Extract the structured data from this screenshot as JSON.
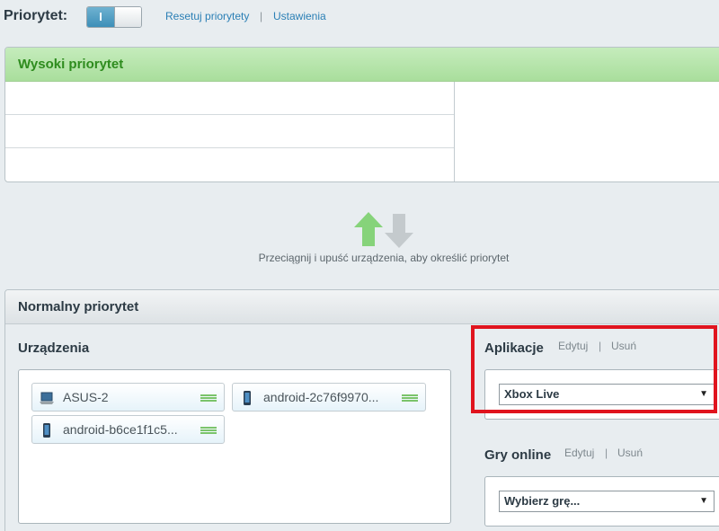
{
  "topbar": {
    "priority_label": "Priorytet:",
    "toggle_state": "I",
    "reset_link": "Resetuj priorytety",
    "separator": "|",
    "settings_link": "Ustawienia"
  },
  "high_priority": {
    "title": "Wysoki priorytet"
  },
  "drag_hint": "Przeciągnij i upuść urządzenia, aby określić priorytet",
  "normal_priority": {
    "title": "Normalny priorytet",
    "devices": {
      "title": "Urządzenia",
      "items": [
        {
          "name": "ASUS-2",
          "icon": "laptop-icon"
        },
        {
          "name": "android-2c76f9970...",
          "icon": "phone-icon"
        },
        {
          "name": "android-b6ce1f1c5...",
          "icon": "phone-icon"
        }
      ]
    },
    "apps": {
      "title": "Aplikacje",
      "edit": "Edytuj",
      "separator": "|",
      "delete": "Usuń",
      "selected": "Xbox Live"
    },
    "games": {
      "title": "Gry online",
      "edit": "Edytuj",
      "separator": "|",
      "delete": "Usuń",
      "selected": "Wybierz grę..."
    }
  },
  "colors": {
    "accent": "#2a7fb5",
    "high_header": "#a9de9c",
    "highlight": "#e0141e"
  }
}
